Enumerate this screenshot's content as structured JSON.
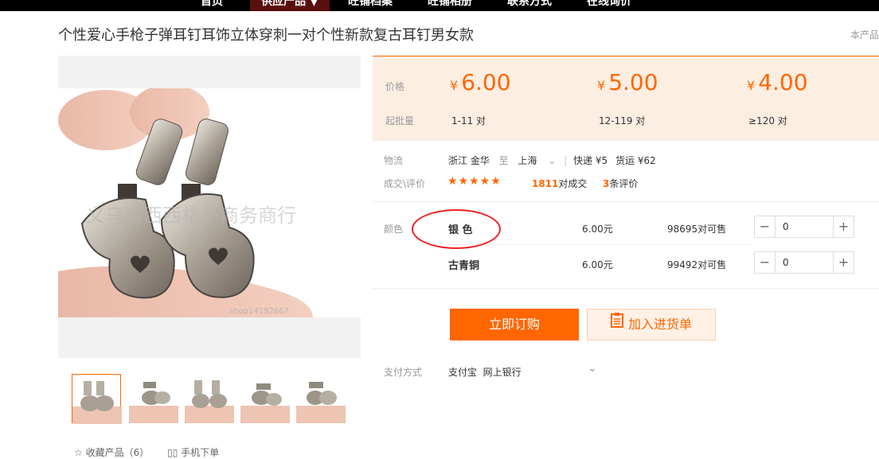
{
  "nav": {
    "items": [
      "首页",
      "供应产品",
      "旺铺档案",
      "旺铺相册",
      "联系方式",
      "在线询价"
    ],
    "active_caret": "▼"
  },
  "product": {
    "title": "个性爱心手枪子弹耳钉耳饰立体穿刺一对个性新款复古耳钉男女款",
    "note": "本产品",
    "watermark": "义乌市西西格子商务商行",
    "watermark_small": "shop14192667"
  },
  "price": {
    "price_label": "价格",
    "batch_label": "起批量",
    "currency": "¥",
    "tiers": [
      {
        "price": "6.00",
        "qty": "1-11 对"
      },
      {
        "price": "5.00",
        "qty": "12-119 对"
      },
      {
        "price": "4.00",
        "qty": "≥120 对"
      }
    ]
  },
  "logistics": {
    "label": "物流",
    "from": "浙江 金华",
    "to_word": "至",
    "to": "上海",
    "express": "快递 ¥5",
    "freight": "货运 ¥62"
  },
  "deals": {
    "label": "成交\\评价",
    "stars": "★★★★★",
    "count": "1811",
    "count_suffix": "对成交",
    "reviews": "3",
    "reviews_suffix": "条评价"
  },
  "sku": {
    "label": "颜色",
    "options": [
      {
        "name": "银 色",
        "price": "6.00元",
        "stock": "98695",
        "stock_suffix": "对可售",
        "qty": "0"
      },
      {
        "name": "古青铜",
        "price": "6.00元",
        "stock": "99492",
        "stock_suffix": "对可售",
        "qty": "0"
      }
    ]
  },
  "actions": {
    "buy": "立即订购",
    "cart": "加入进货单"
  },
  "payment": {
    "label": "支付方式",
    "methods": "支付宝  网上银行"
  },
  "bottom": {
    "fav": "收藏产品（6）",
    "phone": "手机下单"
  },
  "colors": {
    "accent": "#ff6600",
    "price_bg": "#fdeee2",
    "annotation": "#e22222"
  }
}
